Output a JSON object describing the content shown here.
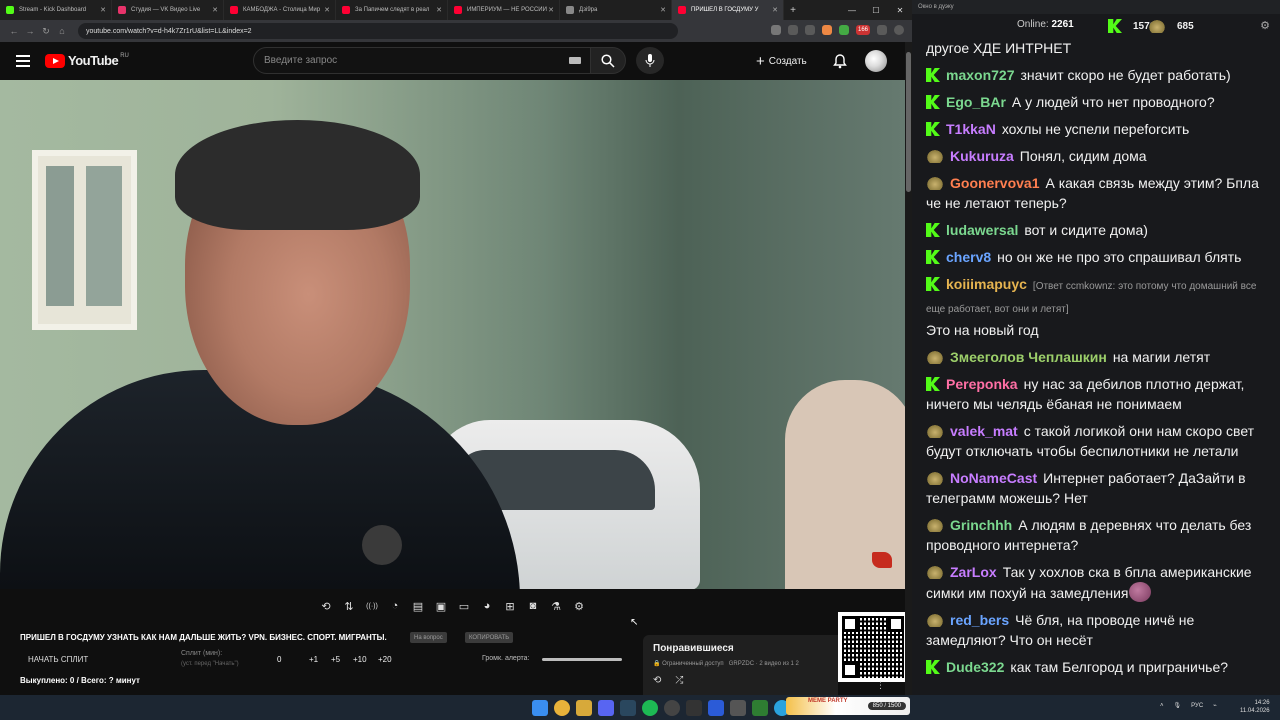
{
  "browser": {
    "tabs": [
      {
        "label": "Stream - Kick Dashboard",
        "color": "#53fc18",
        "active": false
      },
      {
        "label": "Студия — VK Видео Live",
        "color": "#e8336a",
        "active": false
      },
      {
        "label": "КАМБОДЖА - Столица Мир",
        "color": "#ff0033",
        "active": false
      },
      {
        "label": "За Папичем следят в реал",
        "color": "#ff0033",
        "active": false
      },
      {
        "label": "ИМПЕРИУМ — НЕ РОССИИ",
        "color": "#ff0033",
        "active": false
      },
      {
        "label": "Дзi9ра",
        "color": "#888888",
        "active": false
      },
      {
        "label": "ПРИШЕЛ В ГОСДУМУ У",
        "color": "#ff0033",
        "active": true
      }
    ],
    "url": "youtube.com/watch?v=d-h4k7Zr1rU&list=LL&index=2",
    "ext_badge": "166"
  },
  "youtube": {
    "logo_text": "YouTube",
    "logo_region": "RU",
    "search_placeholder": "Введите запрос",
    "create_label": "Создать"
  },
  "player_tools": [
    "loop-icon",
    "sort-icon",
    "audio-icon",
    "watch-later-icon",
    "clapper-icon",
    "pip-icon",
    "mini-icon",
    "speed-icon",
    "add-icon",
    "camera-icon",
    "lab-icon",
    "settings-icon"
  ],
  "panel": {
    "title": "ПРИШЕЛ В ГОСДУМУ УЗНАТЬ КАК НАМ ДАЛЬШЕ ЖИТЬ? VPN. БИЗНЕС. СПОРТ. МИГРАНТЫ.",
    "pill_1": "На вопрос",
    "pill_2": "КОПИРОВАТЬ",
    "split_button": "НАЧАТЬ СПЛИТ",
    "split_label": "Сплит (мин):",
    "split_sub": "(уст. перед \"Начать\")",
    "split_value": "0",
    "increments": [
      "+1",
      "+5",
      "+10",
      "+20"
    ],
    "alert_label": "Громк. алерта:",
    "bought": "Выкуплено: 0 / Всего: ? минут"
  },
  "liked": {
    "title": "Понравившиеся",
    "access": "Ограниченный доступ",
    "meta": "GRPZDC · 2 видео из 1 2"
  },
  "chat": {
    "window_title": "Окно в дуэку",
    "online_label": "Online:",
    "online": "2261",
    "stat_kick": "1576",
    "stat_other": "685",
    "messages": [
      {
        "badge": "",
        "nick": "",
        "color": "#ffffff",
        "reply": "",
        "text": "другое ХДЕ ИНТРНЕТ"
      },
      {
        "badge": "k",
        "nick": "maxon727",
        "color": "#7bd88f",
        "reply": "",
        "text": "значит скоро не будет работать)"
      },
      {
        "badge": "k",
        "nick": "Ego_BAr",
        "color": "#7bd88f",
        "reply": "",
        "text": "А у людей что нет проводного?"
      },
      {
        "badge": "k",
        "nick": "T1kkaN",
        "color": "#c77dff",
        "reply": "",
        "text": "хохлы не успели переforсить"
      },
      {
        "badge": "t",
        "nick": "Kukuruza",
        "color": "#c77dff",
        "reply": "",
        "text": "Понял, сидим дома"
      },
      {
        "badge": "t",
        "nick": "Goonervova1",
        "color": "#ff7f50",
        "reply": "",
        "text": "А какая связь между этим? Бпла че не летают теперь?"
      },
      {
        "badge": "k",
        "nick": "ludawersal",
        "color": "#7bd88f",
        "reply": "",
        "text": "вот и сидите дома)"
      },
      {
        "badge": "k",
        "nick": "cherv8",
        "color": "#6aa4ff",
        "reply": "",
        "text": "но он же не про это спрашивал блять"
      },
      {
        "badge": "k",
        "nick": "koiiimapuyc",
        "color": "#e6b450",
        "reply": "[Ответ ccmkownz: это потому что домашний все еще работает, вот они и летят]",
        "text": "Это на новый год"
      },
      {
        "badge": "t",
        "nick": "Змееголов Чеплашкин",
        "color": "#9ccf6a",
        "reply": "",
        "text": "на магии летят"
      },
      {
        "badge": "k",
        "nick": "Pereponka",
        "color": "#ff6fa5",
        "reply": "",
        "text": "ну нас за дебилов плотно держат, ничего мы челядь ёбаная не понимаем"
      },
      {
        "badge": "t",
        "nick": "valek_mat",
        "color": "#c77dff",
        "reply": "",
        "text": "с такой логикой они нам скоро свет будут отключать чтобы беспилотники не летали"
      },
      {
        "badge": "t",
        "nick": "NoNameCast",
        "color": "#c77dff",
        "reply": "",
        "text": "Интернет работает? ДаЗайти в телеграмм можешь? Нет"
      },
      {
        "badge": "t",
        "nick": "Grinchhh",
        "color": "#7bd88f",
        "reply": "",
        "text": "А людям в деревнях что делать без проводного интернета?"
      },
      {
        "badge": "t",
        "nick": "ZarLox",
        "color": "#c77dff",
        "reply": "",
        "text": "Так у хохлов ска в бпла американские симки им похуй на замедления",
        "emote": true
      },
      {
        "badge": "t",
        "nick": "red_bers",
        "color": "#6aa4ff",
        "reply": "",
        "text": "Чё бля, на проводе ничё не замедляют? Что он несёт"
      },
      {
        "badge": "k",
        "nick": "Dude322",
        "color": "#7bd88f",
        "reply": "",
        "text": "как там Белгород и приграничье?"
      }
    ]
  },
  "taskbar": {
    "meme_label": "MEME PARTY",
    "meme_count": "850 / 1500",
    "lang": "РУС",
    "time": "14:26",
    "date": "11.04.2026"
  }
}
